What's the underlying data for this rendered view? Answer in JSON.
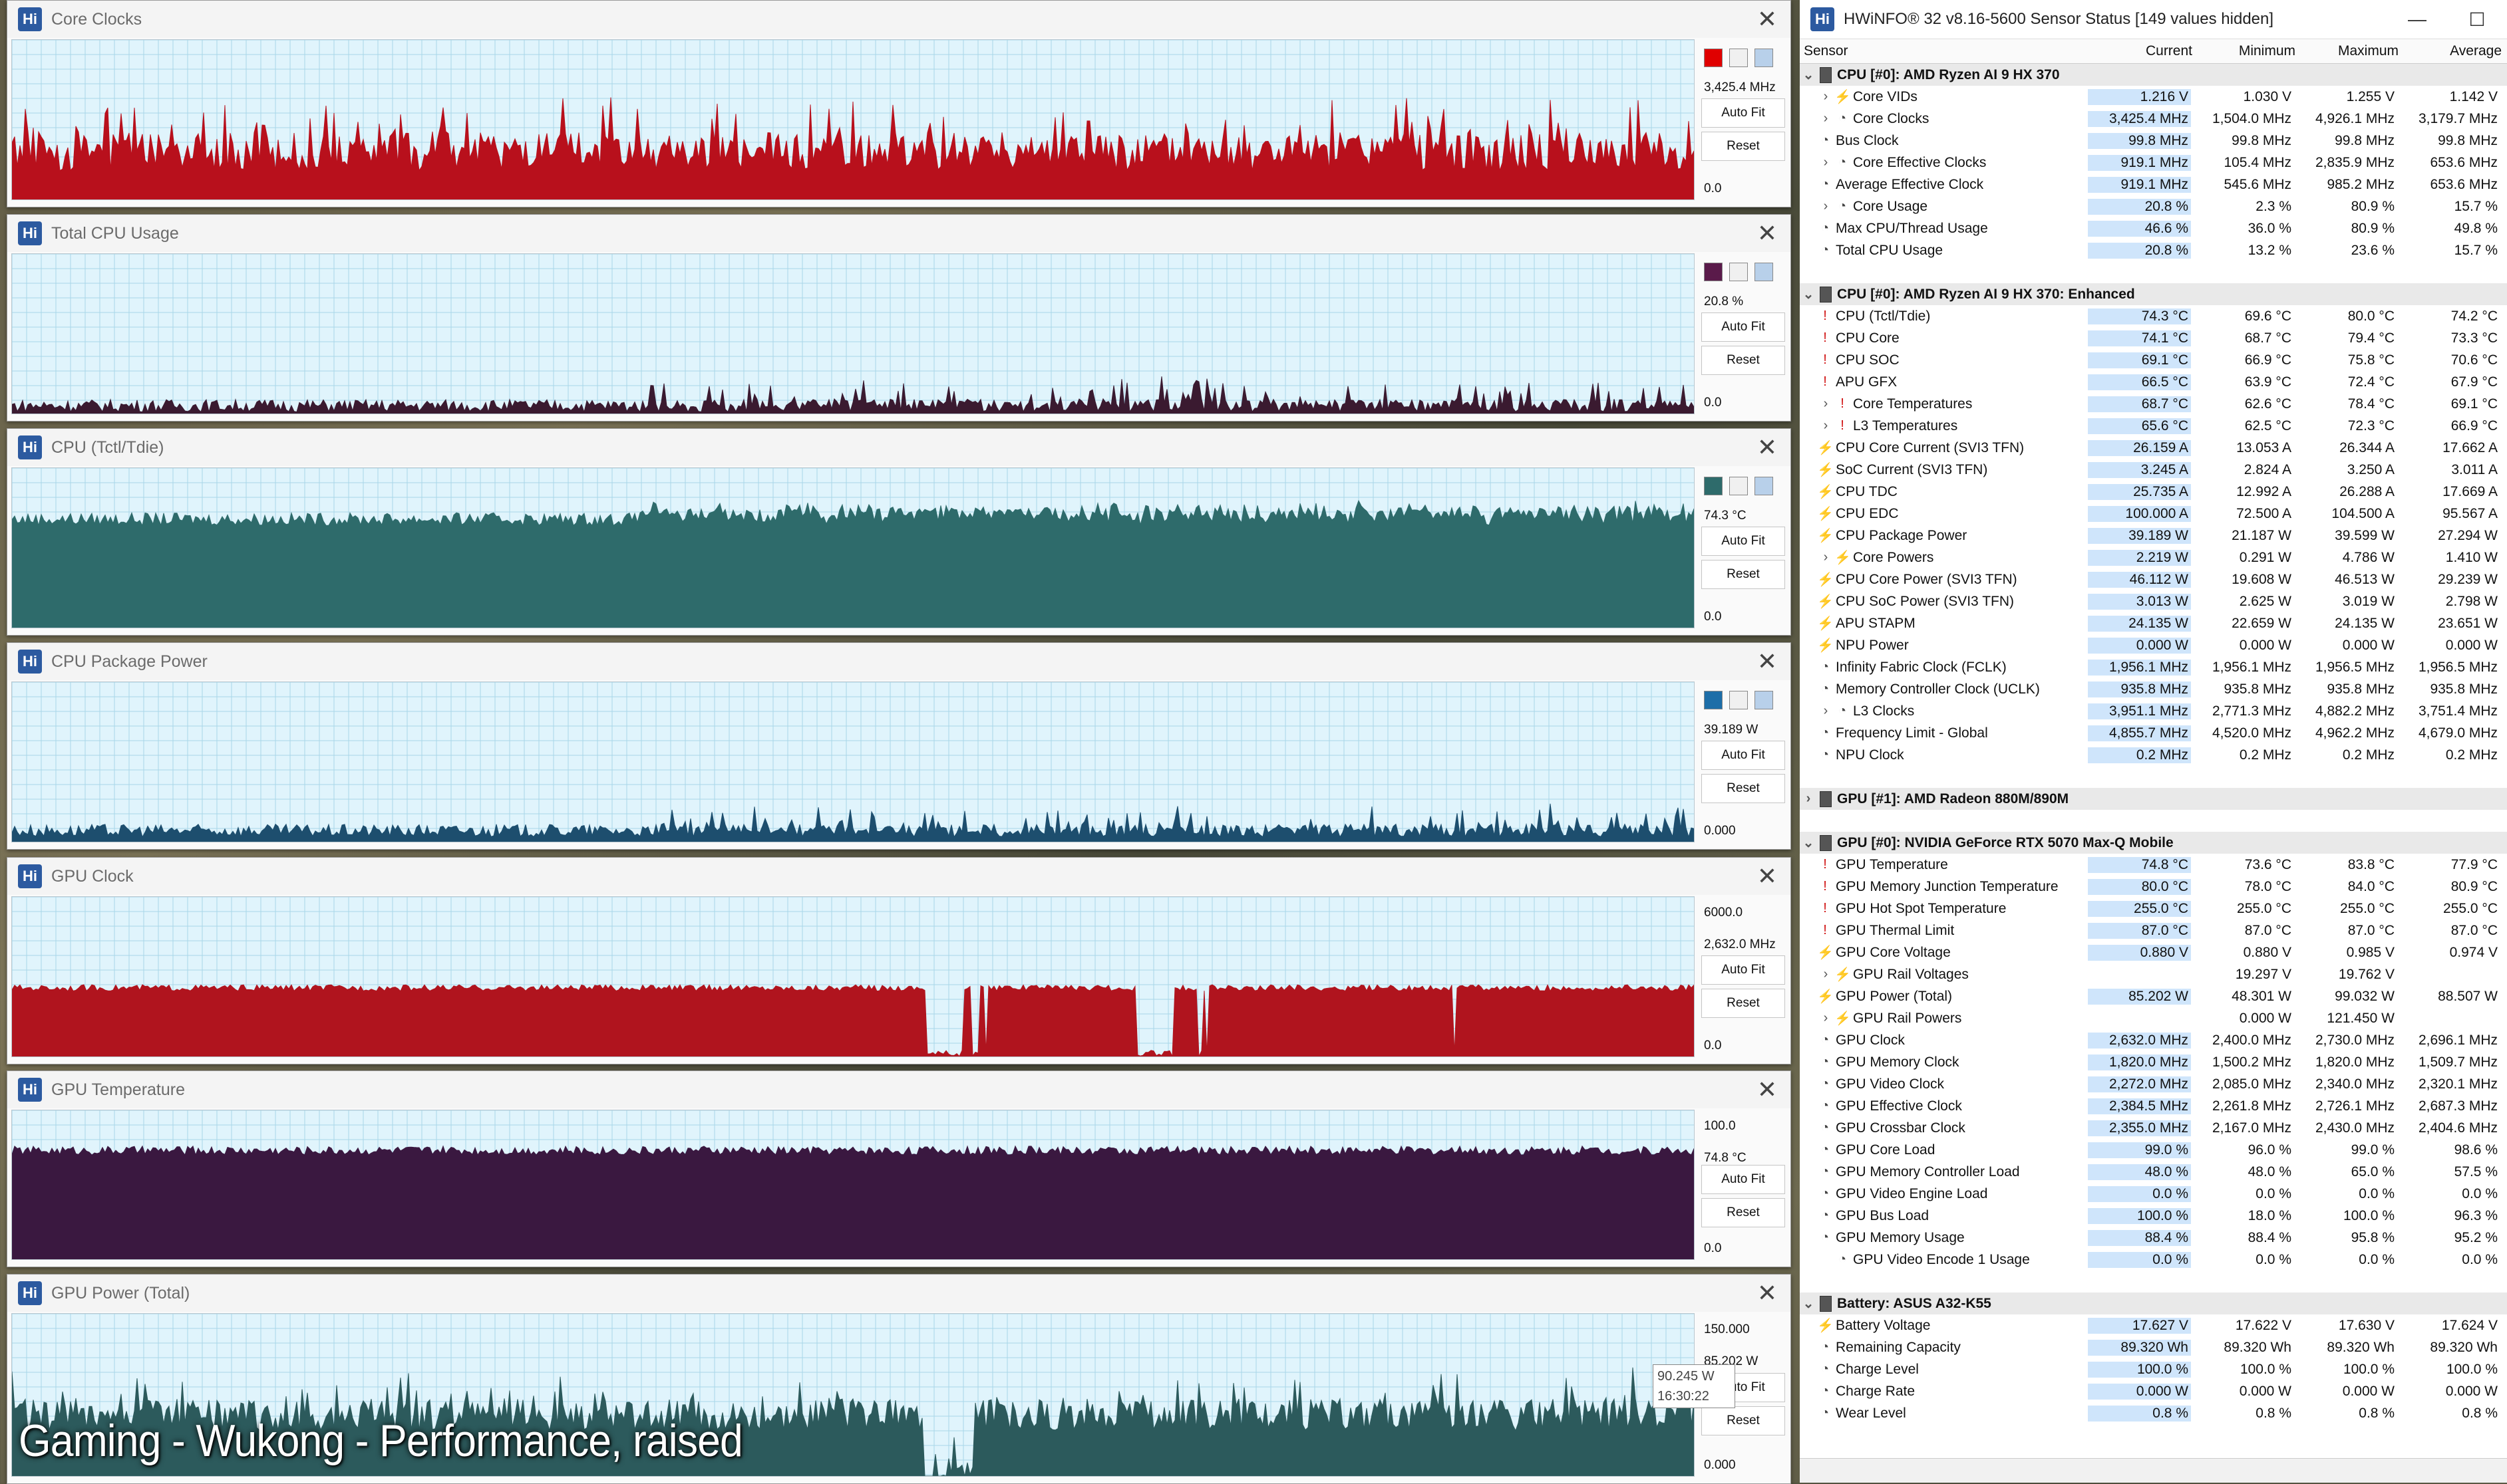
{
  "caption": "Gaming - Wukong - Performance, raised",
  "graphs": [
    {
      "title": "Core Clocks",
      "color": "#b8101c",
      "swatch": "#e00000",
      "values": [
        "3,425.4 MHz"
      ],
      "min_label": "0.0",
      "level": 0.3,
      "noise": 0.12,
      "spiky": true
    },
    {
      "title": "Total CPU Usage",
      "color": "#3a1a30",
      "swatch": "#5a1a4a",
      "values": [
        "20.8 %"
      ],
      "min_label": "0.0",
      "level": 0.05,
      "noise": 0.04,
      "spiky": false
    },
    {
      "title": "CPU (Tctl/Tdie)",
      "color": "#2e6b6b",
      "swatch": "#2e6b6b",
      "values": [
        "74.3 °C"
      ],
      "min_label": "0.0",
      "level": 0.68,
      "noise": 0.04,
      "spiky": false
    },
    {
      "title": "CPU Package Power",
      "color": "#1d4e6e",
      "swatch": "#1d6ea8",
      "values": [
        "39.189 W"
      ],
      "min_label": "0.000",
      "level": 0.07,
      "noise": 0.04,
      "spiky": false
    },
    {
      "title": "GPU Clock",
      "color": "#b0141e",
      "swatch": "#e00000",
      "values": [
        "6000.0",
        "2,632.0 MHz"
      ],
      "min_label": "0.0",
      "level": 0.43,
      "noise": 0.02,
      "spiky": false
    },
    {
      "title": "GPU Temperature",
      "color": "#3a1840",
      "swatch": "#5a1a4a",
      "values": [
        "100.0",
        "74.8 °C"
      ],
      "min_label": "0.0",
      "level": 0.73,
      "noise": 0.03,
      "spiky": false
    },
    {
      "title": "GPU Power (Total)",
      "color": "#2c5a5c",
      "swatch": "#2e6b6b",
      "values": [
        "150.000",
        "85.202 W"
      ],
      "min_label": "0.000",
      "level": 0.38,
      "noise": 0.1,
      "spiky": true
    }
  ],
  "buttons": {
    "autofit": "Auto Fit",
    "reset": "Reset"
  },
  "tooltip": {
    "value": "90.245 W",
    "time": "16:30:22"
  },
  "hwinfo": {
    "title": "HWiNFO® 32 v8.16-5600 Sensor Status [149 values hidden]",
    "columns": [
      "Sensor",
      "Current",
      "Minimum",
      "Maximum",
      "Average"
    ],
    "rows": [
      {
        "g": true,
        "name": "CPU [#0]: AMD Ryzen AI 9 HX 370"
      },
      {
        "i": "volt",
        "sub": true,
        "name": "Core VIDs",
        "v": [
          "1.216 V",
          "1.030 V",
          "1.255 V",
          "1.142 V"
        ]
      },
      {
        "i": "clock",
        "sub": true,
        "name": "Core Clocks",
        "v": [
          "3,425.4 MHz",
          "1,504.0 MHz",
          "4,926.1 MHz",
          "3,179.7 MHz"
        ]
      },
      {
        "i": "clock",
        "name": "Bus Clock",
        "v": [
          "99.8 MHz",
          "99.8 MHz",
          "99.8 MHz",
          "99.8 MHz"
        ]
      },
      {
        "i": "clock",
        "sub": true,
        "name": "Core Effective Clocks",
        "v": [
          "919.1 MHz",
          "105.4 MHz",
          "2,835.9 MHz",
          "653.6 MHz"
        ]
      },
      {
        "i": "clock",
        "name": "Average Effective Clock",
        "v": [
          "919.1 MHz",
          "545.6 MHz",
          "985.2 MHz",
          "653.6 MHz"
        ]
      },
      {
        "i": "clock",
        "sub": true,
        "name": "Core Usage",
        "v": [
          "20.8 %",
          "2.3 %",
          "80.9 %",
          "15.7 %"
        ]
      },
      {
        "i": "clock",
        "name": "Max CPU/Thread Usage",
        "v": [
          "46.6 %",
          "36.0 %",
          "80.9 %",
          "49.8 %"
        ]
      },
      {
        "i": "clock",
        "name": "Total CPU Usage",
        "v": [
          "20.8 %",
          "13.2 %",
          "23.6 %",
          "15.7 %"
        ]
      },
      {
        "spacer": true
      },
      {
        "g": true,
        "name": "CPU [#0]: AMD Ryzen AI 9 HX 370: Enhanced"
      },
      {
        "i": "temp",
        "name": "CPU (Tctl/Tdie)",
        "v": [
          "74.3 °C",
          "69.6 °C",
          "80.0 °C",
          "74.2 °C"
        ]
      },
      {
        "i": "temp",
        "name": "CPU Core",
        "v": [
          "74.1 °C",
          "68.7 °C",
          "79.4 °C",
          "73.3 °C"
        ]
      },
      {
        "i": "temp",
        "name": "CPU SOC",
        "v": [
          "69.1 °C",
          "66.9 °C",
          "75.8 °C",
          "70.6 °C"
        ]
      },
      {
        "i": "temp",
        "name": "APU GFX",
        "v": [
          "66.5 °C",
          "63.9 °C",
          "72.4 °C",
          "67.9 °C"
        ]
      },
      {
        "i": "temp",
        "sub": true,
        "name": "Core Temperatures",
        "v": [
          "68.7 °C",
          "62.6 °C",
          "78.4 °C",
          "69.1 °C"
        ]
      },
      {
        "i": "temp",
        "sub": true,
        "name": "L3 Temperatures",
        "v": [
          "65.6 °C",
          "62.5 °C",
          "72.3 °C",
          "66.9 °C"
        ]
      },
      {
        "i": "volt",
        "name": "CPU Core Current (SVI3 TFN)",
        "v": [
          "26.159 A",
          "13.053 A",
          "26.344 A",
          "17.662 A"
        ]
      },
      {
        "i": "volt",
        "name": "SoC Current (SVI3 TFN)",
        "v": [
          "3.245 A",
          "2.824 A",
          "3.250 A",
          "3.011 A"
        ]
      },
      {
        "i": "volt",
        "name": "CPU TDC",
        "v": [
          "25.735 A",
          "12.992 A",
          "26.288 A",
          "17.669 A"
        ]
      },
      {
        "i": "volt",
        "name": "CPU EDC",
        "v": [
          "100.000 A",
          "72.500 A",
          "104.500 A",
          "95.567 A"
        ]
      },
      {
        "i": "volt",
        "name": "CPU Package Power",
        "v": [
          "39.189 W",
          "21.187 W",
          "39.599 W",
          "27.294 W"
        ]
      },
      {
        "i": "volt",
        "sub": true,
        "name": "Core Powers",
        "v": [
          "2.219 W",
          "0.291 W",
          "4.786 W",
          "1.410 W"
        ]
      },
      {
        "i": "volt",
        "name": "CPU Core Power (SVI3 TFN)",
        "v": [
          "46.112 W",
          "19.608 W",
          "46.513 W",
          "29.239 W"
        ]
      },
      {
        "i": "volt",
        "name": "CPU SoC Power (SVI3 TFN)",
        "v": [
          "3.013 W",
          "2.625 W",
          "3.019 W",
          "2.798 W"
        ]
      },
      {
        "i": "volt",
        "name": "APU STAPM",
        "v": [
          "24.135 W",
          "22.659 W",
          "24.135 W",
          "23.651 W"
        ]
      },
      {
        "i": "volt",
        "name": "NPU Power",
        "v": [
          "0.000 W",
          "0.000 W",
          "0.000 W",
          "0.000 W"
        ]
      },
      {
        "i": "clock",
        "name": "Infinity Fabric Clock (FCLK)",
        "v": [
          "1,956.1 MHz",
          "1,956.1 MHz",
          "1,956.5 MHz",
          "1,956.5 MHz"
        ]
      },
      {
        "i": "clock",
        "name": "Memory Controller Clock (UCLK)",
        "v": [
          "935.8 MHz",
          "935.8 MHz",
          "935.8 MHz",
          "935.8 MHz"
        ]
      },
      {
        "i": "clock",
        "sub": true,
        "name": "L3 Clocks",
        "v": [
          "3,951.1 MHz",
          "2,771.3 MHz",
          "4,882.2 MHz",
          "3,751.4 MHz"
        ]
      },
      {
        "i": "clock",
        "name": "Frequency Limit - Global",
        "v": [
          "4,855.7 MHz",
          "4,520.0 MHz",
          "4,962.2 MHz",
          "4,679.0 MHz"
        ]
      },
      {
        "i": "clock",
        "name": "NPU Clock",
        "v": [
          "0.2 MHz",
          "0.2 MHz",
          "0.2 MHz",
          "0.2 MHz"
        ]
      },
      {
        "spacer": true
      },
      {
        "g": true,
        "collapsed": true,
        "name": "GPU [#1]: AMD Radeon 880M/890M"
      },
      {
        "spacer": true
      },
      {
        "g": true,
        "name": "GPU [#0]: NVIDIA  GeForce RTX 5070 Max-Q Mobile"
      },
      {
        "i": "temp",
        "name": "GPU Temperature",
        "v": [
          "74.8 °C",
          "73.6 °C",
          "83.8 °C",
          "77.9 °C"
        ]
      },
      {
        "i": "temp",
        "name": "GPU Memory Junction Temperature",
        "v": [
          "80.0 °C",
          "78.0 °C",
          "84.0 °C",
          "80.9 °C"
        ]
      },
      {
        "i": "temp",
        "name": "GPU Hot Spot Temperature",
        "v": [
          "255.0 °C",
          "255.0 °C",
          "255.0 °C",
          "255.0 °C"
        ]
      },
      {
        "i": "temp",
        "name": "GPU Thermal Limit",
        "v": [
          "87.0 °C",
          "87.0 °C",
          "87.0 °C",
          "87.0 °C"
        ]
      },
      {
        "i": "volt",
        "name": "GPU Core Voltage",
        "v": [
          "0.880 V",
          "0.880 V",
          "0.985 V",
          "0.974 V"
        ]
      },
      {
        "i": "volt",
        "sub": true,
        "name": "GPU Rail Voltages",
        "v": [
          "",
          "19.297 V",
          "19.762 V",
          ""
        ]
      },
      {
        "i": "volt",
        "name": "GPU Power (Total)",
        "v": [
          "85.202 W",
          "48.301 W",
          "99.032 W",
          "88.507 W"
        ]
      },
      {
        "i": "volt",
        "sub": true,
        "name": "GPU Rail Powers",
        "v": [
          "",
          "0.000 W",
          "121.450 W",
          ""
        ]
      },
      {
        "i": "clock",
        "name": "GPU Clock",
        "v": [
          "2,632.0 MHz",
          "2,400.0 MHz",
          "2,730.0 MHz",
          "2,696.1 MHz"
        ]
      },
      {
        "i": "clock",
        "name": "GPU Memory Clock",
        "v": [
          "1,820.0 MHz",
          "1,500.2 MHz",
          "1,820.0 MHz",
          "1,509.7 MHz"
        ]
      },
      {
        "i": "clock",
        "name": "GPU Video Clock",
        "v": [
          "2,272.0 MHz",
          "2,085.0 MHz",
          "2,340.0 MHz",
          "2,320.1 MHz"
        ]
      },
      {
        "i": "clock",
        "name": "GPU Effective Clock",
        "v": [
          "2,384.5 MHz",
          "2,261.8 MHz",
          "2,726.1 MHz",
          "2,687.3 MHz"
        ]
      },
      {
        "i": "clock",
        "name": "GPU Crossbar Clock",
        "v": [
          "2,355.0 MHz",
          "2,167.0 MHz",
          "2,430.0 MHz",
          "2,404.6 MHz"
        ]
      },
      {
        "i": "clock",
        "name": "GPU Core Load",
        "v": [
          "99.0 %",
          "96.0 %",
          "99.0 %",
          "98.6 %"
        ]
      },
      {
        "i": "clock",
        "name": "GPU Memory Controller Load",
        "v": [
          "48.0 %",
          "48.0 %",
          "65.0 %",
          "57.5 %"
        ]
      },
      {
        "i": "clock",
        "name": "GPU Video Engine Load",
        "v": [
          "0.0 %",
          "0.0 %",
          "0.0 %",
          "0.0 %"
        ]
      },
      {
        "i": "clock",
        "name": "GPU Bus Load",
        "v": [
          "100.0 %",
          "18.0 %",
          "100.0 %",
          "96.3 %"
        ]
      },
      {
        "i": "clock",
        "name": "GPU Memory Usage",
        "v": [
          "88.4 %",
          "88.4 %",
          "95.8 %",
          "95.2 %"
        ]
      },
      {
        "i": "clock",
        "sub": true,
        "nochev": true,
        "name": "GPU Video Encode 1 Usage",
        "v": [
          "0.0 %",
          "0.0 %",
          "0.0 %",
          "0.0 %"
        ]
      },
      {
        "spacer": true
      },
      {
        "g": true,
        "name": "Battery: ASUS  A32-K55"
      },
      {
        "i": "volt",
        "name": "Battery Voltage",
        "v": [
          "17.627 V",
          "17.622 V",
          "17.630 V",
          "17.624 V"
        ]
      },
      {
        "i": "clock",
        "name": "Remaining Capacity",
        "v": [
          "89.320 Wh",
          "89.320 Wh",
          "89.320 Wh",
          "89.320 Wh"
        ]
      },
      {
        "i": "clock",
        "name": "Charge Level",
        "v": [
          "100.0 %",
          "100.0 %",
          "100.0 %",
          "100.0 %"
        ]
      },
      {
        "i": "clock",
        "name": "Charge Rate",
        "v": [
          "0.000 W",
          "0.000 W",
          "0.000 W",
          "0.000 W"
        ]
      },
      {
        "i": "clock",
        "name": "Wear Level",
        "v": [
          "0.8 %",
          "0.8 %",
          "0.8 %",
          "0.8 %"
        ]
      }
    ]
  }
}
